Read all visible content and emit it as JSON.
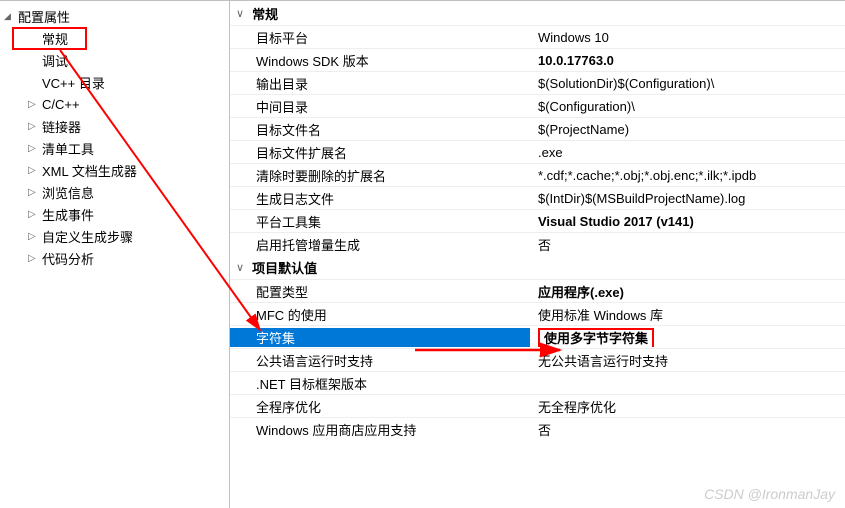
{
  "sidebar": {
    "root": "配置属性",
    "items": [
      {
        "label": "常规",
        "type": "leaf",
        "highlighted": true
      },
      {
        "label": "调试",
        "type": "leaf"
      },
      {
        "label": "VC++ 目录",
        "type": "leaf"
      },
      {
        "label": "C/C++",
        "type": "expandable"
      },
      {
        "label": "链接器",
        "type": "expandable"
      },
      {
        "label": "清单工具",
        "type": "expandable"
      },
      {
        "label": "XML 文档生成器",
        "type": "expandable"
      },
      {
        "label": "浏览信息",
        "type": "expandable"
      },
      {
        "label": "生成事件",
        "type": "expandable"
      },
      {
        "label": "自定义生成步骤",
        "type": "expandable"
      },
      {
        "label": "代码分析",
        "type": "expandable"
      }
    ]
  },
  "sections": [
    {
      "title": "常规",
      "rows": [
        {
          "label": "目标平台",
          "value": "Windows 10"
        },
        {
          "label": "Windows SDK 版本",
          "value": "10.0.17763.0",
          "bold": true
        },
        {
          "label": "输出目录",
          "value": "$(SolutionDir)$(Configuration)\\"
        },
        {
          "label": "中间目录",
          "value": "$(Configuration)\\"
        },
        {
          "label": "目标文件名",
          "value": "$(ProjectName)"
        },
        {
          "label": "目标文件扩展名",
          "value": ".exe"
        },
        {
          "label": "清除时要删除的扩展名",
          "value": "*.cdf;*.cache;*.obj;*.obj.enc;*.ilk;*.ipdb"
        },
        {
          "label": "生成日志文件",
          "value": "$(IntDir)$(MSBuildProjectName).log"
        },
        {
          "label": "平台工具集",
          "value": "Visual Studio 2017 (v141)",
          "bold": true
        },
        {
          "label": "启用托管增量生成",
          "value": "否"
        }
      ]
    },
    {
      "title": "项目默认值",
      "rows": [
        {
          "label": "配置类型",
          "value": "应用程序(.exe)",
          "bold": true
        },
        {
          "label": "MFC 的使用",
          "value": "使用标准 Windows 库"
        },
        {
          "label": "字符集",
          "value": "使用多字节字符集",
          "bold": true,
          "selected": true,
          "valueHighlight": true
        },
        {
          "label": "公共语言运行时支持",
          "value": "无公共语言运行时支持"
        },
        {
          "label": ".NET 目标框架版本",
          "value": ""
        },
        {
          "label": "全程序优化",
          "value": "无全程序优化"
        },
        {
          "label": "Windows 应用商店应用支持",
          "value": "否"
        }
      ]
    }
  ],
  "watermark": "CSDN @IronmanJay"
}
